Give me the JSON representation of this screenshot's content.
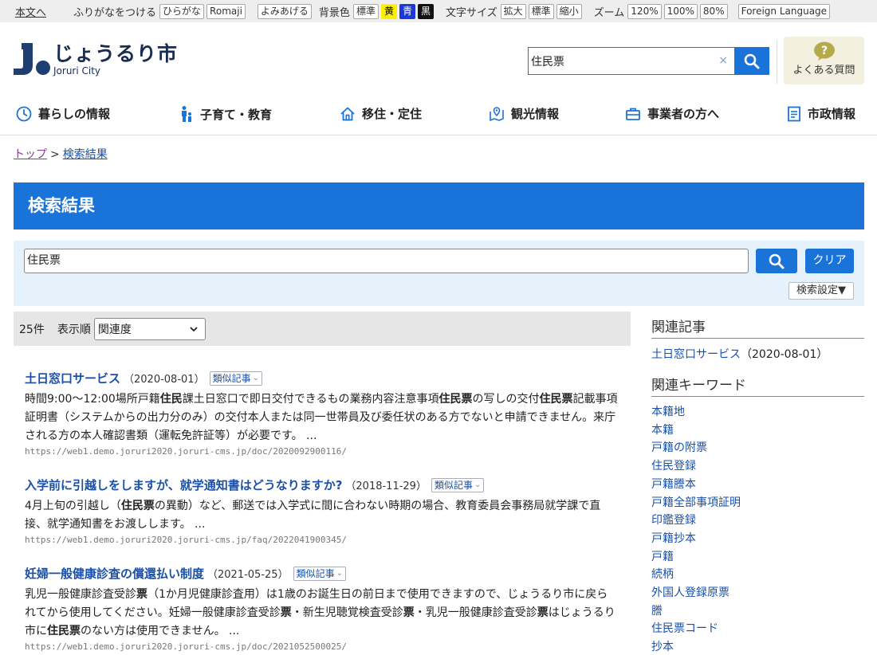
{
  "utility": {
    "skip": "本文へ",
    "furigana_label": "ふりがなをつける",
    "furigana_options": [
      "ひらがな",
      "Romaji"
    ],
    "readaloud": "よみあげる",
    "bg_label": "背景色",
    "bg_options": [
      "標準",
      "黄",
      "青",
      "黒"
    ],
    "fontsize_label": "文字サイズ",
    "fontsize_options": [
      "拡大",
      "標準",
      "縮小"
    ],
    "zoom_label": "ズーム",
    "zoom_options": [
      "120%",
      "100%",
      "80%"
    ],
    "foreign": "Foreign Language"
  },
  "header": {
    "logo_name": "じょうるり市",
    "logo_sub": "Joruri City",
    "search_value": "住民票",
    "search_clear": "×",
    "faq_label": "よくある質問"
  },
  "nav": [
    {
      "label": "暮らしの情報",
      "icon": "clock-icon"
    },
    {
      "label": "子育て・教育",
      "icon": "parent-child-icon"
    },
    {
      "label": "移住・定住",
      "icon": "house-icon"
    },
    {
      "label": "観光情報",
      "icon": "map-pin-icon"
    },
    {
      "label": "事業者の方へ",
      "icon": "briefcase-icon"
    },
    {
      "label": "市政情報",
      "icon": "document-icon"
    }
  ],
  "breadcrumb": {
    "home": "トップ",
    "sep": ">",
    "current": "検索結果"
  },
  "page_title": "検索結果",
  "search_panel": {
    "value": "住民票",
    "clear_label": "クリア",
    "settings_label": "検索設定▼"
  },
  "results_bar": {
    "count": "25件",
    "sort_label": "表示順",
    "sort_value": "関連度"
  },
  "results": [
    {
      "title": "土日窓口サービス",
      "date": "（2020-08-01）",
      "tag": "類似記事",
      "snippet_html": "時間9:00～12:00場所戸籍<b>住民</b>課土日窓口で即日交付できるもの業務内容注意事項<b>住民票</b>の写しの交付<b>住民票</b>記載事項証明書（システムからの出力分のみ）の交付本人または同一世帯員及び委任状のある方でないと申請できません。来庁される方の本人確認書類（運転免許証等）が必要です。 ...",
      "url": "https://web1.demo.joruri2020.joruri-cms.jp/doc/2020092900116/"
    },
    {
      "title": "入学前に引越しをしますが、就学通知書はどうなりますか?",
      "date": "（2018-11-29）",
      "tag": "類似記事",
      "snippet_html": "4月上旬の引越し（<b>住民票</b>の異動）など、郵送では入学式に間に合わない時期の場合、教育委員会事務局就学課で直接、就学通知書をお渡しします。 ...",
      "url": "https://web1.demo.joruri2020.joruri-cms.jp/faq/2022041900345/"
    },
    {
      "title": "妊婦一般健康診査の償還払い制度",
      "date": "（2021-05-25）",
      "tag": "類似記事",
      "snippet_html": "乳児一般健康診査受診<b>票</b>（1か月児健康診査用）は1歳のお誕生日の前日まで使用できますので、じょうるり市に戻られてから使用してください。妊婦一般健康診査受診<b>票</b>・新生児聴覚検査受診<b>票</b>・乳児一般健康診査受診<b>票</b>はじょうるり市に<b>住民票</b>のない方は使用できません。 ...",
      "url": "https://web1.demo.joruri2020.joruri-cms.jp/doc/2021052500025/"
    }
  ],
  "sidebar": {
    "related_heading": "関連記事",
    "related_link": "土日窓口サービス",
    "related_date": "（2020-08-01）",
    "keywords_heading": "関連キーワード",
    "keywords": [
      "本籍地",
      "本籍",
      "戸籍の附票",
      "住民登録",
      "戸籍謄本",
      "戸籍全部事項証明",
      "印鑑登録",
      "戸籍抄本",
      "戸籍",
      "続柄",
      "外国人登録原票",
      "謄",
      "住民票コード",
      "抄本"
    ]
  },
  "colors": {
    "accent": "#1a73d8",
    "link": "#1a50a8",
    "panel": "#e5f1fb"
  }
}
